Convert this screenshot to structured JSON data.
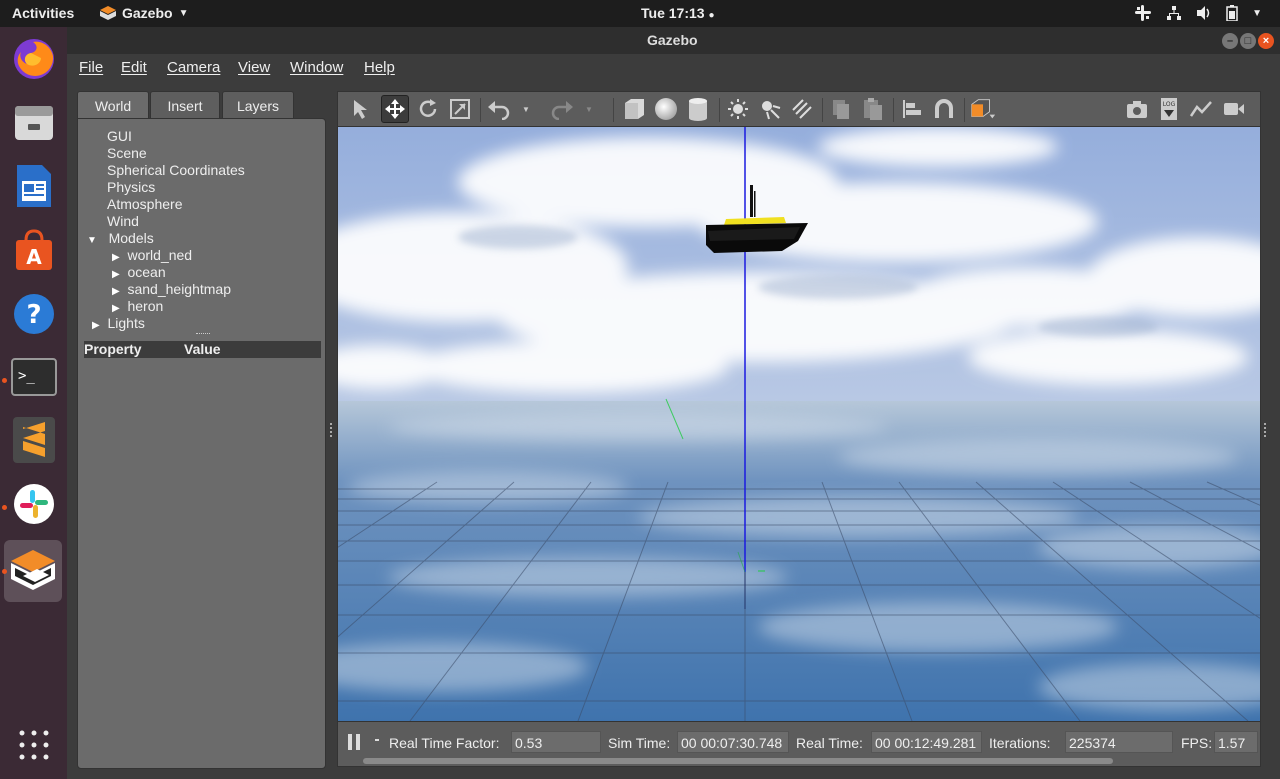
{
  "topbar": {
    "activities": "Activities",
    "app_name": "Gazebo",
    "clock": "Tue 17:13"
  },
  "window": {
    "title": "Gazebo"
  },
  "menu": [
    "File",
    "Edit",
    "Camera",
    "View",
    "Window",
    "Help"
  ],
  "left_panel": {
    "tabs": [
      "World",
      "Insert",
      "Layers"
    ],
    "active_tab": "World",
    "tree": {
      "gui": "GUI",
      "scene": "Scene",
      "spherical": "Spherical Coordinates",
      "physics": "Physics",
      "atmosphere": "Atmosphere",
      "wind": "Wind",
      "models": "Models",
      "models_children": [
        "world_ned",
        "ocean",
        "sand_heightmap",
        "heron"
      ],
      "lights": "Lights"
    },
    "property_header": "Property",
    "value_header": "Value"
  },
  "toolbar": {
    "log_label": "LOG"
  },
  "status": {
    "rtf_label": "Real Time Factor:",
    "rtf_value": "0.53",
    "sim_time_label": "Sim Time:",
    "sim_time_value": "00 00:07:30.748",
    "real_time_label": "Real Time:",
    "real_time_value": "00 00:12:49.281",
    "iterations_label": "Iterations:",
    "iterations_value": "225374",
    "fps_label": "FPS:",
    "fps_value": "1.57"
  },
  "colors": {
    "accent": "#e95420",
    "dock_bg": "#3b2a35",
    "window_bg": "#3c3c3c",
    "panel_bg": "#6b6b6b",
    "sky": "#a9bde0",
    "sea": "#4f7fb0",
    "boat_deck": "#f0e020"
  }
}
